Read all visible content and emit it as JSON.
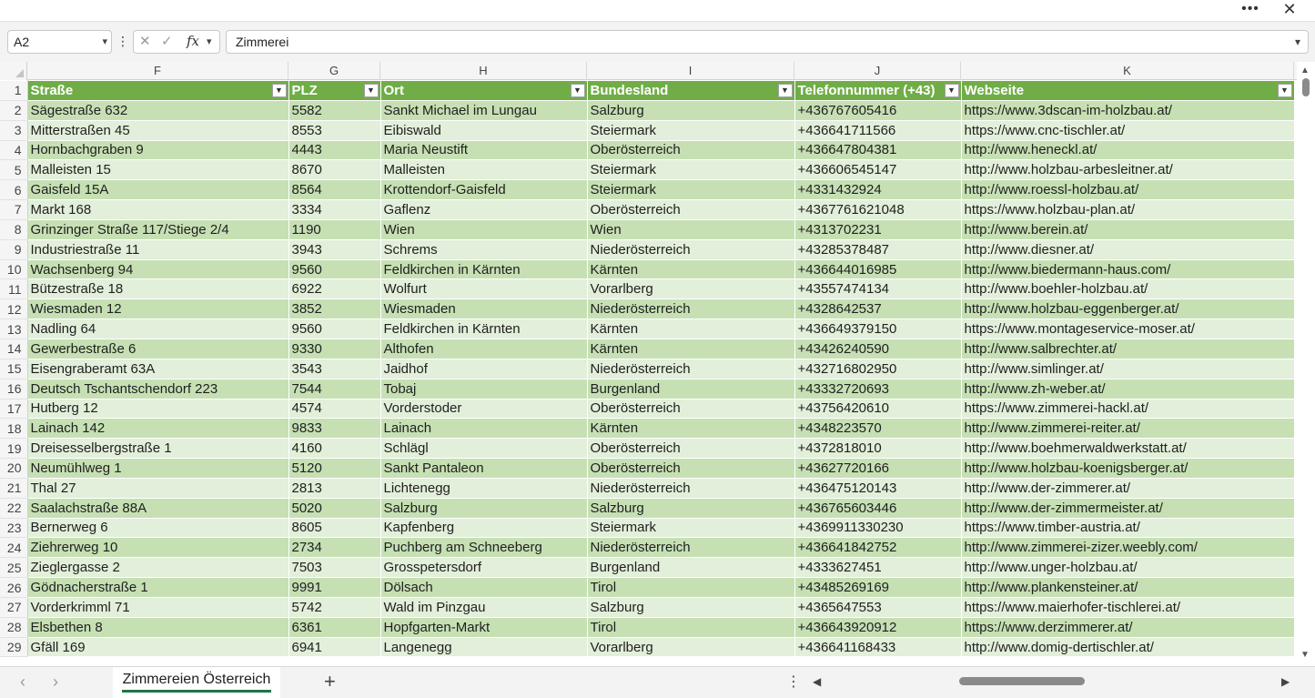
{
  "window": {
    "more_icon": "more-icon",
    "close_icon": "close-icon"
  },
  "formula_bar": {
    "name_box": "A2",
    "formula": "Zimmerei"
  },
  "columns": [
    "F",
    "G",
    "H",
    "I",
    "J",
    "K"
  ],
  "headers": [
    "Straße",
    "PLZ",
    "Ort",
    "Bundesland",
    "Telefonnummer (+43)",
    "Webseite"
  ],
  "rows": [
    {
      "n": "2",
      "cells": [
        "Sägestraße 632",
        "5582",
        "Sankt Michael im Lungau",
        "Salzburg",
        "+436767605416",
        "https://www.3dscan-im-holzbau.at/"
      ]
    },
    {
      "n": "3",
      "cells": [
        "Mitterstraßen 45",
        "8553",
        "Eibiswald",
        "Steiermark",
        "+436641711566",
        "https://www.cnc-tischler.at/"
      ]
    },
    {
      "n": "4",
      "cells": [
        "Hornbachgraben 9",
        "4443",
        "Maria Neustift",
        "Oberösterreich",
        "+436647804381",
        "http://www.heneckl.at/"
      ]
    },
    {
      "n": "5",
      "cells": [
        "Malleisten 15",
        "8670",
        "Malleisten",
        "Steiermark",
        "+436606545147",
        "http://www.holzbau-arbesleitner.at/"
      ]
    },
    {
      "n": "6",
      "cells": [
        "Gaisfeld 15A",
        "8564",
        "Krottendorf-Gaisfeld",
        "Steiermark",
        "+4331432924",
        "http://www.roessl-holzbau.at/"
      ]
    },
    {
      "n": "7",
      "cells": [
        "Markt 168",
        "3334",
        "Gaflenz",
        "Oberösterreich",
        "+4367761621048",
        "https://www.holzbau-plan.at/"
      ]
    },
    {
      "n": "8",
      "cells": [
        "Grinzinger Straße 117/Stiege 2/4",
        "1190",
        "Wien",
        "Wien",
        "+4313702231",
        "http://www.berein.at/"
      ]
    },
    {
      "n": "9",
      "cells": [
        "Industriestraße 11",
        "3943",
        "Schrems",
        "Niederösterreich",
        "+43285378487",
        "http://www.diesner.at/"
      ]
    },
    {
      "n": "10",
      "cells": [
        "Wachsenberg 94",
        "9560",
        "Feldkirchen in Kärnten",
        "Kärnten",
        "+436644016985",
        "http://www.biedermann-haus.com/"
      ]
    },
    {
      "n": "11",
      "cells": [
        "Bützestraße 18",
        "6922",
        "Wolfurt",
        "Vorarlberg",
        "+43557474134",
        "http://www.boehler-holzbau.at/"
      ]
    },
    {
      "n": "12",
      "cells": [
        "Wiesmaden 12",
        "3852",
        "Wiesmaden",
        "Niederösterreich",
        "+4328642537",
        "http://www.holzbau-eggenberger.at/"
      ]
    },
    {
      "n": "13",
      "cells": [
        "Nadling 64",
        "9560",
        "Feldkirchen in Kärnten",
        "Kärnten",
        "+436649379150",
        "https://www.montageservice-moser.at/"
      ]
    },
    {
      "n": "14",
      "cells": [
        "Gewerbestraße 6",
        "9330",
        "Althofen",
        "Kärnten",
        "+43426240590",
        "http://www.salbrechter.at/"
      ]
    },
    {
      "n": "15",
      "cells": [
        "Eisengraberamt 63A",
        "3543",
        "Jaidhof",
        "Niederösterreich",
        "+432716802950",
        "http://www.simlinger.at/"
      ]
    },
    {
      "n": "16",
      "cells": [
        "Deutsch Tschantschendorf 223",
        "7544",
        "Tobaj",
        "Burgenland",
        "+43332720693",
        "http://www.zh-weber.at/"
      ]
    },
    {
      "n": "17",
      "cells": [
        "Hutberg 12",
        "4574",
        "Vorderstoder",
        "Oberösterreich",
        "+43756420610",
        "https://www.zimmerei-hackl.at/"
      ]
    },
    {
      "n": "18",
      "cells": [
        "Lainach 142",
        "9833",
        "Lainach",
        "Kärnten",
        "+4348223570",
        "http://www.zimmerei-reiter.at/"
      ]
    },
    {
      "n": "19",
      "cells": [
        "Dreisesselbergstraße 1",
        "4160",
        "Schlägl",
        "Oberösterreich",
        "+4372818010",
        "http://www.boehmerwaldwerkstatt.at/"
      ]
    },
    {
      "n": "20",
      "cells": [
        "Neumühlweg 1",
        "5120",
        "Sankt Pantaleon",
        "Oberösterreich",
        "+43627720166",
        "http://www.holzbau-koenigsberger.at/"
      ]
    },
    {
      "n": "21",
      "cells": [
        "Thal 27",
        "2813",
        "Lichtenegg",
        "Niederösterreich",
        "+436475120143",
        "http://www.der-zimmerer.at/"
      ]
    },
    {
      "n": "22",
      "cells": [
        "Saalachstraße 88A",
        "5020",
        "Salzburg",
        "Salzburg",
        "+436765603446",
        "http://www.der-zimmermeister.at/"
      ]
    },
    {
      "n": "23",
      "cells": [
        "Bernerweg 6",
        "8605",
        "Kapfenberg",
        "Steiermark",
        "+4369911330230",
        "https://www.timber-austria.at/"
      ]
    },
    {
      "n": "24",
      "cells": [
        "Ziehrerweg 10",
        "2734",
        "Puchberg am Schneeberg",
        "Niederösterreich",
        "+436641842752",
        "http://www.zimmerei-zizer.weebly.com/"
      ]
    },
    {
      "n": "25",
      "cells": [
        "Zieglergasse 2",
        "7503",
        "Grosspetersdorf",
        "Burgenland",
        "+4333627451",
        "http://www.unger-holzbau.at/"
      ]
    },
    {
      "n": "26",
      "cells": [
        "Gödnacherstraße 1",
        "9991",
        "Dölsach",
        "Tirol",
        "+43485269169",
        "http://www.plankensteiner.at/"
      ]
    },
    {
      "n": "27",
      "cells": [
        "Vorderkrimml 71",
        "5742",
        "Wald im Pinzgau",
        "Salzburg",
        "+4365647553",
        "https://www.maierhofer-tischlerei.at/"
      ]
    },
    {
      "n": "28",
      "cells": [
        "Elsbethen 8",
        "6361",
        "Hopfgarten-Markt",
        "Tirol",
        "+436643920912",
        "https://www.derzimmerer.at/"
      ]
    },
    {
      "n": "29",
      "cells": [
        "Gfäll 169",
        "6941",
        "Langenegg",
        "Vorarlberg",
        "+436641168433",
        "http://www.domig-dertischler.at/"
      ]
    }
  ],
  "sheet_tab": "Zimmereien Österreich",
  "colors": {
    "header_green": "#70ad47",
    "band_dark": "#c6e0b4",
    "band_light": "#e2efda",
    "accent": "#217346"
  }
}
